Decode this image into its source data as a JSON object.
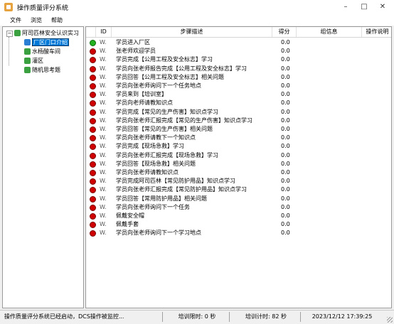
{
  "window": {
    "title": "操作质量评分系统",
    "minimize": "–",
    "maximize": "□",
    "close": "✕"
  },
  "menu": [
    "文件",
    "浏览",
    "帮助"
  ],
  "tree": {
    "root": {
      "label": "阿司匹林安全认识实习",
      "expander": "−"
    },
    "children": [
      {
        "label": "厂区门口介绍",
        "selected": true,
        "color": "#2a7fd4"
      },
      {
        "label": "水杨酸车间",
        "selected": false,
        "color": "#3aa040"
      },
      {
        "label": "灌区",
        "selected": false,
        "color": "#3aa040"
      },
      {
        "label": "随机思考题",
        "selected": false,
        "color": "#3aa040"
      }
    ]
  },
  "table": {
    "headers": {
      "id": "ID",
      "desc": "步骤描述",
      "score": "得分",
      "group": "组信息",
      "note": "操作说明"
    },
    "rows": [
      {
        "status": "green",
        "id": "W.",
        "desc": "学员进入厂区",
        "score": "0.0"
      },
      {
        "status": "red",
        "id": "W.",
        "desc": "张老师欢迎学员",
        "score": "0.0"
      },
      {
        "status": "red",
        "id": "W.",
        "desc": "学员完成【公用工程及安全标志】学习",
        "score": "0.0"
      },
      {
        "status": "red",
        "id": "W.",
        "desc": "学员向张老师报告完成【公用工程及安全标志】学习",
        "score": "0.0"
      },
      {
        "status": "red",
        "id": "W.",
        "desc": "学员回答【公用工程及安全标志】相关问题",
        "score": "0.0"
      },
      {
        "status": "red",
        "id": "W.",
        "desc": "学员向张老师询问下一个任务地点",
        "score": "0.0"
      },
      {
        "status": "red",
        "id": "W.",
        "desc": "学员来到【培训室】",
        "score": "0.0"
      },
      {
        "status": "red",
        "id": "W.",
        "desc": "学员向老师请教知识点",
        "score": "0.0"
      },
      {
        "status": "red",
        "id": "W.",
        "desc": "学员完成【常见的生产伤害】知识点学习",
        "score": "0.0"
      },
      {
        "status": "red",
        "id": "W.",
        "desc": "学员向张老师汇报完成【常见的生产伤害】知识点学习",
        "score": "0.0"
      },
      {
        "status": "red",
        "id": "W.",
        "desc": "学员回答【常见的生产伤害】相关问题",
        "score": "0.0"
      },
      {
        "status": "red",
        "id": "W.",
        "desc": "学员向张老师请教下一个知识点",
        "score": "0.0"
      },
      {
        "status": "red",
        "id": "W.",
        "desc": "学员完成【现场急救】学习",
        "score": "0.0"
      },
      {
        "status": "red",
        "id": "W.",
        "desc": "学员向张老师汇报完成【现场急救】学习",
        "score": "0.0"
      },
      {
        "status": "red",
        "id": "W.",
        "desc": "学员回答【现场急救】相关问题",
        "score": "0.0"
      },
      {
        "status": "red",
        "id": "W.",
        "desc": "学员向张老师请教知识点",
        "score": "0.0"
      },
      {
        "status": "red",
        "id": "W.",
        "desc": "学员完成阿司匹林【常见防护用品】知识点学习",
        "score": "0.0"
      },
      {
        "status": "red",
        "id": "W.",
        "desc": "学员向张老师汇报完成【常见防护用品】知识点学习",
        "score": "0.0"
      },
      {
        "status": "red",
        "id": "W.",
        "desc": "学员回答【常用防护用品】相关问题",
        "score": "0.0"
      },
      {
        "status": "red",
        "id": "W.",
        "desc": "学员向张老师询问下一个任务",
        "score": "0.0"
      },
      {
        "status": "red",
        "id": "W.",
        "desc": "佩戴安全帽",
        "score": "0.0"
      },
      {
        "status": "red",
        "id": "W.",
        "desc": "佩戴手套",
        "score": "0.0"
      },
      {
        "status": "red",
        "id": "W.",
        "desc": "学员向张老师询问下一个学习地点",
        "score": "0.0"
      }
    ]
  },
  "statusbar": {
    "message": "操作质量评分系统已经启动，DCS操作被监控...",
    "train_limit": "培训限时: 0 秒",
    "train_timer": "培训计时: 82 秒",
    "datetime": "2023/12/12 17:39:25"
  }
}
